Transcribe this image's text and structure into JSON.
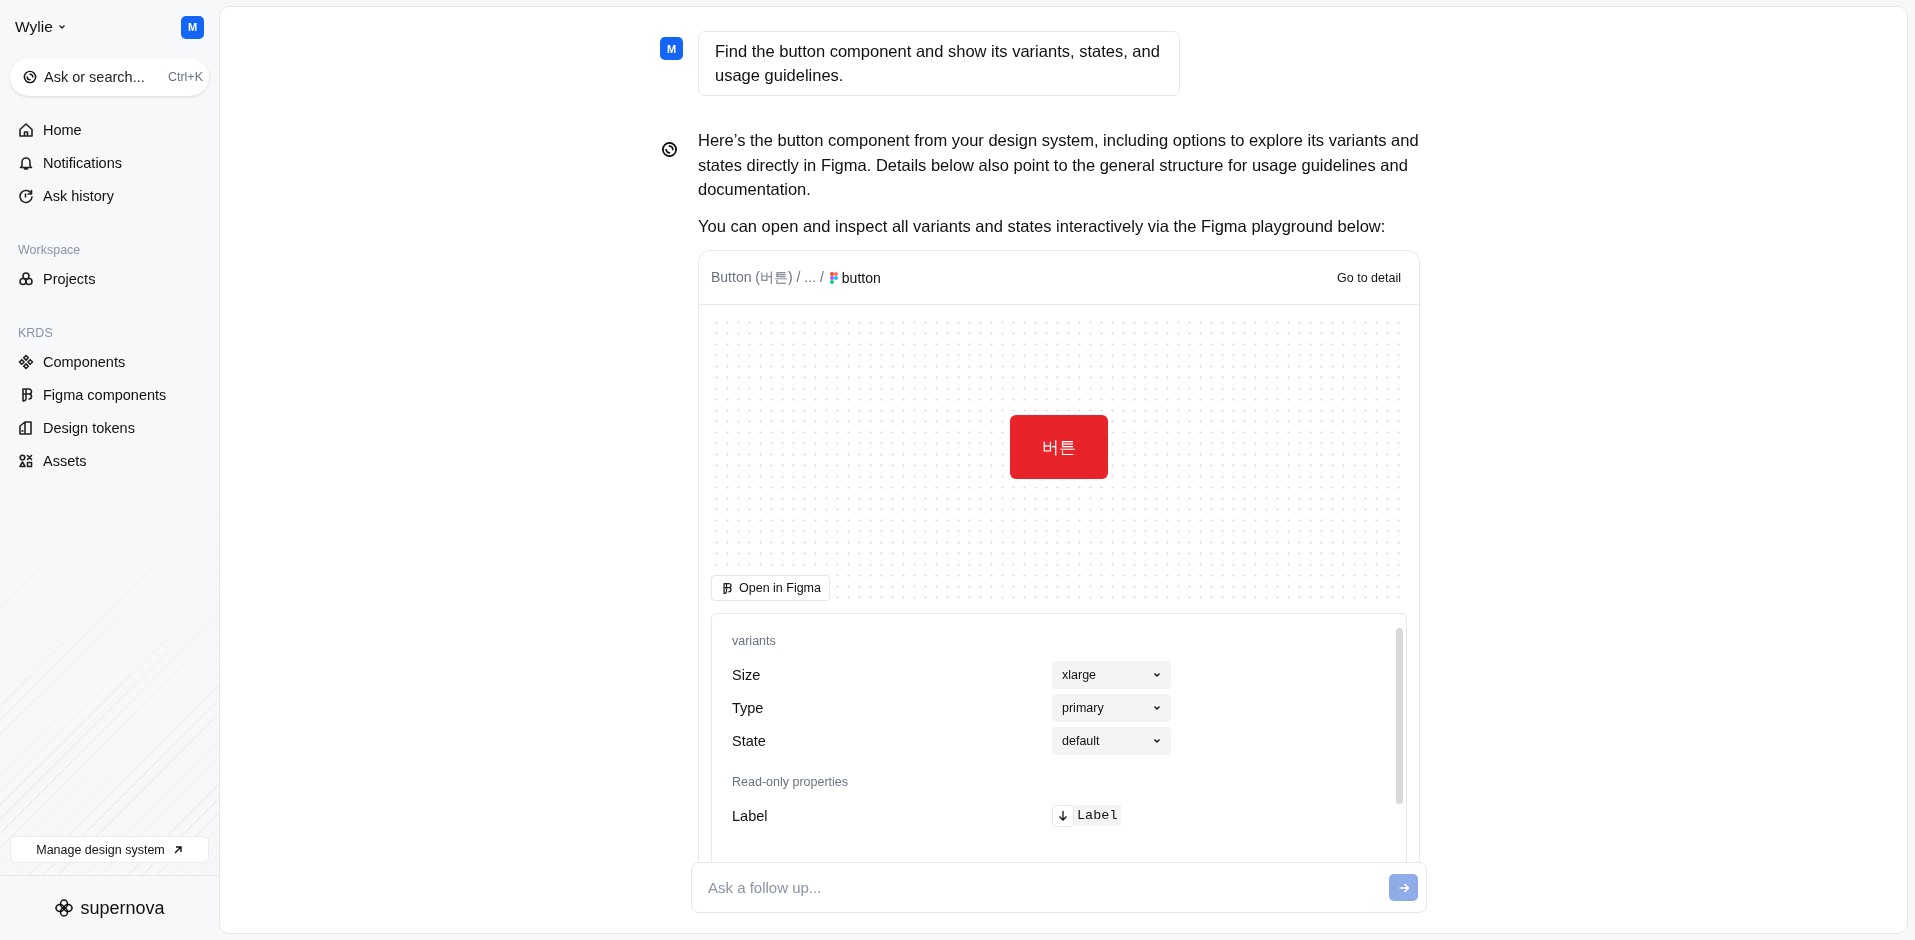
{
  "sidebar": {
    "workspace": "Wylie",
    "avatar": "M",
    "search": {
      "placeholder": "Ask or search...",
      "shortcut": "Ctrl+K"
    },
    "nav": [
      {
        "label": "Home",
        "kind": "home"
      },
      {
        "label": "Notifications",
        "kind": "bell"
      },
      {
        "label": "Ask history",
        "kind": "history"
      }
    ],
    "sections": [
      {
        "title": "Workspace",
        "items": [
          {
            "label": "Projects",
            "kind": "projects"
          }
        ]
      },
      {
        "title": "KRDS",
        "items": [
          {
            "label": "Components",
            "kind": "components"
          },
          {
            "label": "Figma components",
            "kind": "figma"
          },
          {
            "label": "Design tokens",
            "kind": "tokens"
          },
          {
            "label": "Assets",
            "kind": "assets"
          }
        ]
      }
    ],
    "manage_button": "Manage design system",
    "brand": "supernova"
  },
  "chat": {
    "user_message": {
      "avatar": "M",
      "text": "Find the button component and show its variants, states, and usage guidelines."
    },
    "assistant_message": {
      "paragraphs": [
        "Here’s the button component from your design system, including options to explore its variants and states directly in Figma. Details below also point to the general structure for usage guidelines and documentation.",
        "You can open and inspect all variants and states interactively via the Figma playground below:"
      ]
    },
    "card": {
      "breadcrumb": "Button (버튼) / ... /",
      "current": "button",
      "action": "Go to detail",
      "preview_button": "버튼",
      "open_button": "Open in Figma",
      "sections": [
        {
          "title": "variants",
          "rows": [
            {
              "label": "Size",
              "value": "xlarge",
              "kind": "select"
            },
            {
              "label": "Type",
              "value": "primary",
              "kind": "select"
            },
            {
              "label": "State",
              "value": "default",
              "kind": "select"
            }
          ]
        },
        {
          "title": "Read-only properties",
          "rows": [
            {
              "label": "Label",
              "value": "Label",
              "kind": "code"
            }
          ]
        }
      ]
    },
    "input": {
      "placeholder": "Ask a follow up..."
    }
  }
}
